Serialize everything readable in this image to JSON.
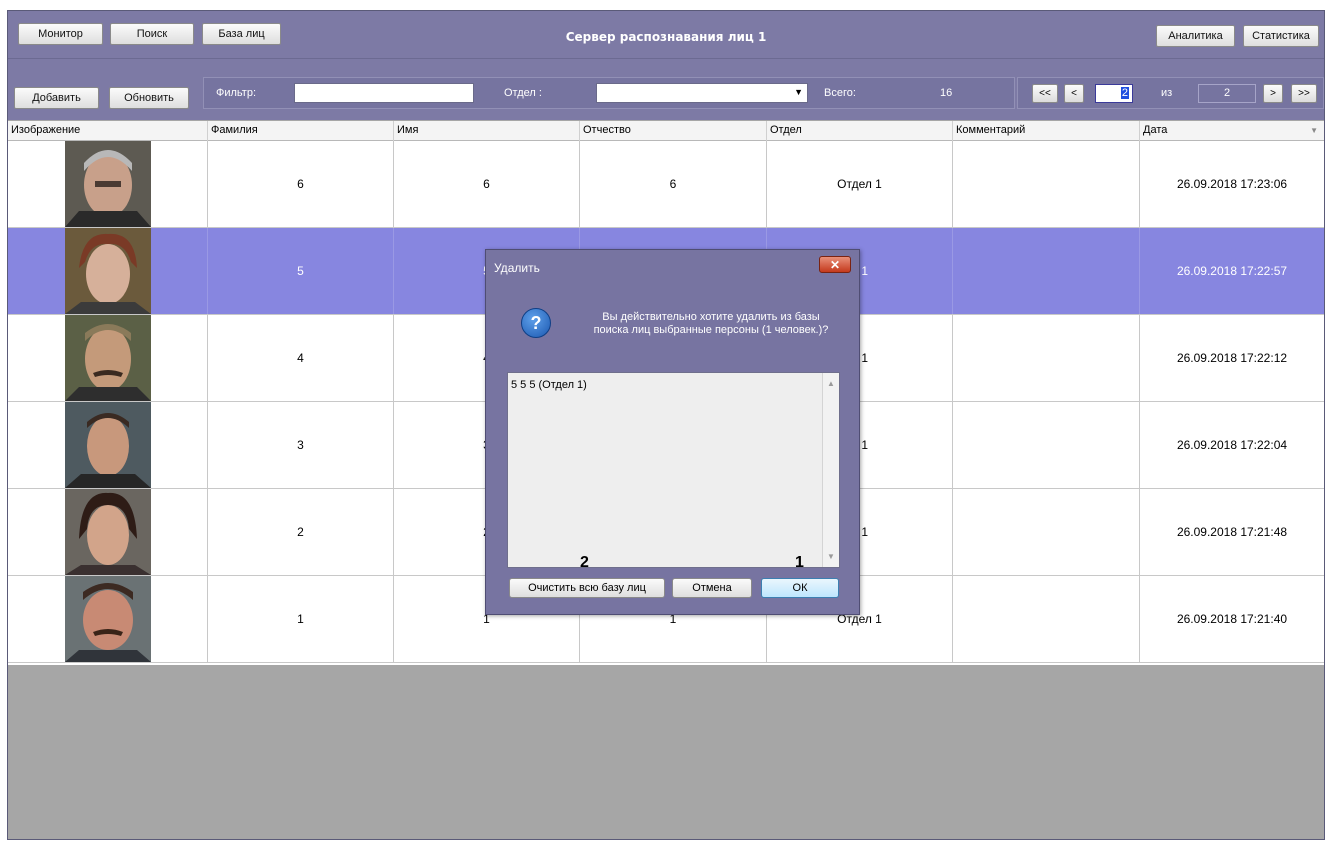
{
  "nav": {
    "monitor": "Монитор",
    "search": "Поиск",
    "face_base": "База лиц",
    "analytics": "Аналитика",
    "statistics": "Статистика"
  },
  "title": "Сервер распознавания лиц 1",
  "toolbar": {
    "add": "Добавить",
    "refresh": "Обновить",
    "filter_label": "Фильтр:",
    "filter_value": "",
    "department_label": "Отдел :",
    "department_value": "",
    "total_label": "Всего:",
    "total_value": "16"
  },
  "pager": {
    "first": "<<",
    "prev": "<",
    "current": "2",
    "of_label": "из",
    "total": "2",
    "next": ">",
    "last": ">>"
  },
  "table": {
    "headers": [
      "Изображение",
      "Фамилия",
      "Имя",
      "Отчество",
      "Отдел",
      "Комментарий",
      "Дата"
    ],
    "rows": [
      {
        "last": "6",
        "first": "6",
        "middle": "6",
        "dept": "Отдел 1",
        "comment": "",
        "date": "26.09.2018 17:23:06",
        "selected": false
      },
      {
        "last": "5",
        "first": "5",
        "middle": "",
        "dept": "л 1",
        "comment": "",
        "date": "26.09.2018 17:22:57",
        "selected": true
      },
      {
        "last": "4",
        "first": "4",
        "middle": "",
        "dept": "л 1",
        "comment": "",
        "date": "26.09.2018 17:22:12",
        "selected": false
      },
      {
        "last": "3",
        "first": "3",
        "middle": "",
        "dept": "л 1",
        "comment": "",
        "date": "26.09.2018 17:22:04",
        "selected": false
      },
      {
        "last": "2",
        "first": "2",
        "middle": "",
        "dept": "л 1",
        "comment": "",
        "date": "26.09.2018 17:21:48",
        "selected": false
      },
      {
        "last": "1",
        "first": "1",
        "middle": "1",
        "dept": "Отдел 1",
        "comment": "",
        "date": "26.09.2018 17:21:40",
        "selected": false
      }
    ]
  },
  "dialog": {
    "title": "Удалить",
    "close": "✕",
    "icon": "question-icon",
    "message_line1": "Вы действительно хотите удалить из базы",
    "message_line2": "поиска лиц выбранные персоны (1 человек.)?",
    "list_text": "5 5 5 (Отдел 1)",
    "clear_all": "Очистить всю базу лиц",
    "cancel": "Отмена",
    "ok": "ОК",
    "marker_ok": "1",
    "marker_clear": "2"
  },
  "colors": {
    "panel": "#7d7aa5",
    "selected_row": "#8786e0",
    "workspace": "#a6a6a6"
  }
}
